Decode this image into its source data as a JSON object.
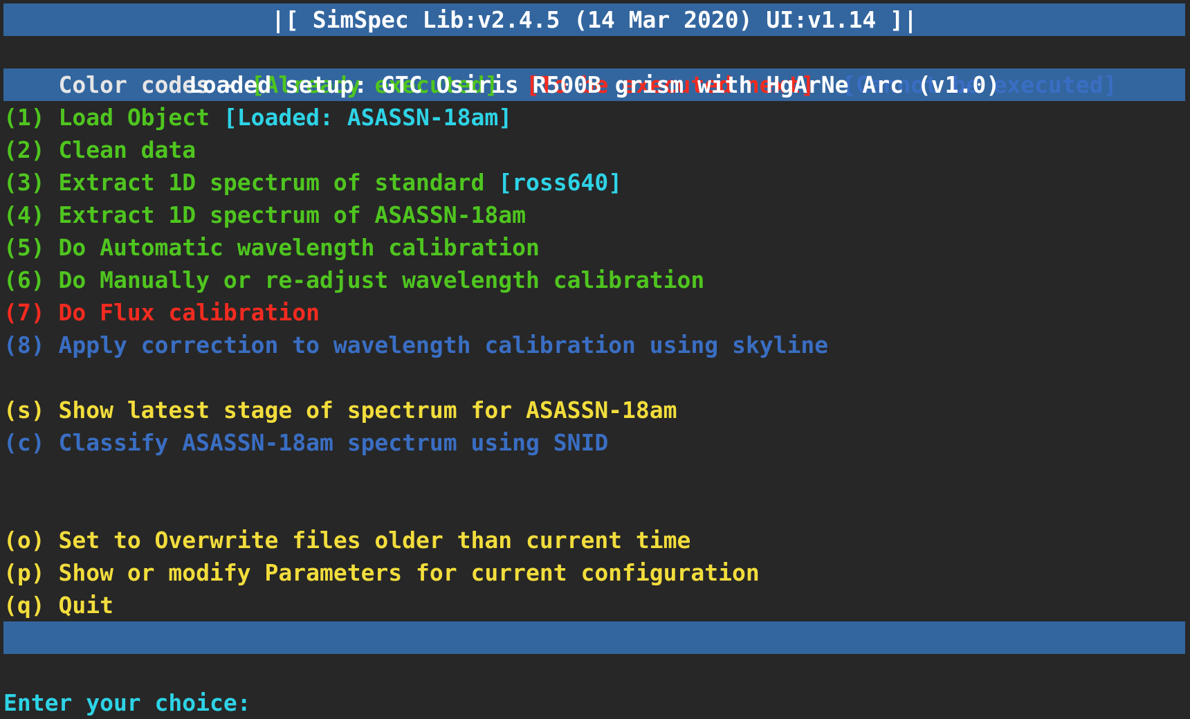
{
  "app": {
    "title_bar": "|[ SimSpec Lib:v2.4.5 (14 Mar 2020) UI:v1.14 ]|",
    "setup_bar": "Loaded setup: GTC Osiris R500B grism with HgArNe Arc (v1.0)",
    "bottom_bar": " "
  },
  "legend": {
    "prefix": "Color codes - ",
    "executed": "[Already executed]",
    "separator_1": "  ",
    "next": "[To be executed next]",
    "separator_2": "  ",
    "blocked": "[Cannot be executed]"
  },
  "menu": {
    "numbered": [
      {
        "key": "(1)",
        "text": " Load Object ",
        "value": "[Loaded: ASASSN-18am]",
        "state": "executed"
      },
      {
        "key": "(2)",
        "text": " Clean data",
        "value": "",
        "state": "executed"
      },
      {
        "key": "(3)",
        "text": " Extract 1D spectrum of standard ",
        "value": "[ross640]",
        "state": "executed"
      },
      {
        "key": "(4)",
        "text": " Extract 1D spectrum of ASASSN-18am",
        "value": "",
        "state": "executed"
      },
      {
        "key": "(5)",
        "text": " Do Automatic wavelength calibration",
        "value": "",
        "state": "executed"
      },
      {
        "key": "(6)",
        "text": " Do Manually or re-adjust wavelength calibration",
        "value": "",
        "state": "executed"
      },
      {
        "key": "(7)",
        "text": " Do Flux calibration",
        "value": "",
        "state": "next"
      },
      {
        "key": "(8)",
        "text": " Apply correction to wavelength calibration using skyline",
        "value": "",
        "state": "blocked"
      }
    ],
    "lettered_group_1": [
      {
        "key": "(s)",
        "text": " Show latest stage of spectrum for ASASSN-18am",
        "state": "available"
      },
      {
        "key": "(c)",
        "text": " Classify ASASSN-18am spectrum using SNID",
        "state": "blocked"
      }
    ],
    "lettered_group_2": [
      {
        "key": "(o)",
        "text": " Set to Overwrite files older than current time",
        "state": "available"
      },
      {
        "key": "(p)",
        "text": " Show or modify Parameters for current configuration",
        "state": "available"
      },
      {
        "key": "(q)",
        "text": " Quit",
        "state": "available"
      }
    ]
  },
  "prompt": {
    "label": "Enter your choice:"
  },
  "colors": {
    "background": "#272727",
    "bar_blue": "#33669f",
    "executed_green": "#4fc51f",
    "next_red": "#f42b20",
    "blocked_blue": "#3a6ec3",
    "available_yellow": "#f2dd3c",
    "value_cyan": "#2ed3e6",
    "legend_white": "#e6e6e6"
  }
}
